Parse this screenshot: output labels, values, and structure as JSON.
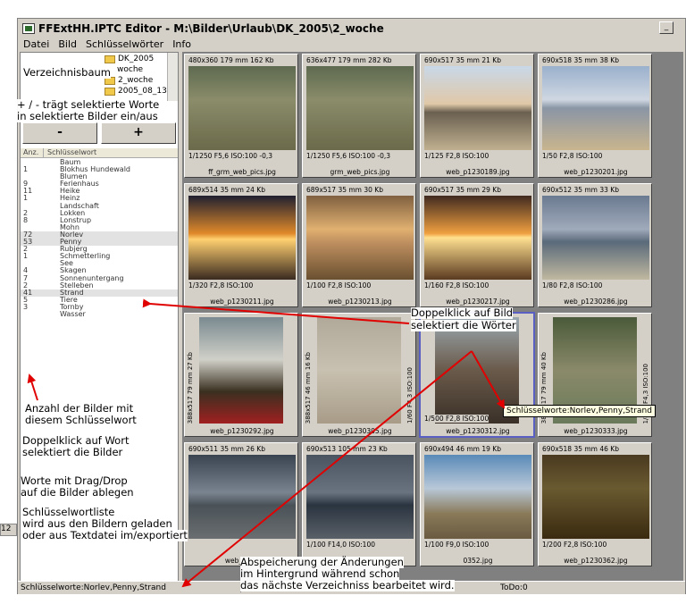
{
  "window": {
    "title": "FFExtHH.IPTC Editor - M:\\Bilder\\Urlaub\\DK_2005\\2_woche"
  },
  "menu": [
    "Datei",
    "Bild",
    "Schlüsselwörter",
    "Info"
  ],
  "tree": {
    "nodes": [
      "DK_2005",
      "woche",
      "2_woche",
      "2005_08_13"
    ]
  },
  "buttons": {
    "minus": "-",
    "plus": "+"
  },
  "keyword_table": {
    "headers": [
      "Anz.",
      "Schlüsselwort"
    ],
    "rows": [
      {
        "count": "",
        "word": "Baum",
        "selected": false
      },
      {
        "count": "1",
        "word": "Blokhus Hundewald",
        "selected": false
      },
      {
        "count": "",
        "word": "Blumen",
        "selected": false
      },
      {
        "count": "9",
        "word": "Ferienhaus",
        "selected": false
      },
      {
        "count": "11",
        "word": "Heike",
        "selected": false
      },
      {
        "count": "1",
        "word": "Heinz",
        "selected": false
      },
      {
        "count": "",
        "word": "Landschaft",
        "selected": false
      },
      {
        "count": "2",
        "word": "Lokken",
        "selected": false
      },
      {
        "count": "8",
        "word": "Lonstrup",
        "selected": false
      },
      {
        "count": "",
        "word": "Mohn",
        "selected": false
      },
      {
        "count": "72",
        "word": "Norlev",
        "selected": true
      },
      {
        "count": "53",
        "word": "Penny",
        "selected": true
      },
      {
        "count": "2",
        "word": "Rubjerg",
        "selected": false
      },
      {
        "count": "1",
        "word": "Schmetterling",
        "selected": false
      },
      {
        "count": "",
        "word": "See",
        "selected": false
      },
      {
        "count": "4",
        "word": "Skagen",
        "selected": false
      },
      {
        "count": "7",
        "word": "Sonnenuntergang",
        "selected": false
      },
      {
        "count": "2",
        "word": "Stelleben",
        "selected": false
      },
      {
        "count": "41",
        "word": "Strand",
        "selected": true
      },
      {
        "count": "5",
        "word": "Tiere",
        "selected": false
      },
      {
        "count": "3",
        "word": "Tornby",
        "selected": false
      },
      {
        "count": "",
        "word": "Wasser",
        "selected": false
      }
    ]
  },
  "thumbnails": [
    {
      "info": "480x360 179 mm 162 Kb",
      "exif": "1/1250 F5,6 ISO:100 -0,3",
      "file": "ff_grm_web_pics.jpg"
    },
    {
      "info": "636x477 179 mm 282 Kb",
      "exif": "1/1250 F5,6 ISO:100 -0,3",
      "file": "grm_web_pics.jpg"
    },
    {
      "info": "690x517 35 mm 21 Kb",
      "exif": "1/125 F2,8 ISO:100",
      "file": "web_p1230189.jpg"
    },
    {
      "info": "690x518 35 mm 38 Kb",
      "exif": "1/50 F2,8 ISO:100",
      "file": "web_p1230201.jpg"
    },
    {
      "info": "689x514 35 mm 24 Kb",
      "exif": "1/320 F2,8 ISO:100",
      "file": "web_p1230211.jpg"
    },
    {
      "info": "689x517 35 mm 30 Kb",
      "exif": "1/100 F2,8 ISO:100",
      "file": "web_p1230213.jpg"
    },
    {
      "info": "690x517 35 mm 29 Kb",
      "exif": "1/160 F2,8 ISO:100",
      "file": "web_p1230217.jpg"
    },
    {
      "info": "690x512 35 mm 33 Kb",
      "exif": "1/80 F2,8 ISO:100",
      "file": "web_p1230286.jpg"
    },
    {
      "info": "388x517 79 mm 27 Kb",
      "exif": "",
      "file": "web_p1230292.jpg"
    },
    {
      "info": "388x517 46 mm 16 Kb",
      "exif": "1/60 F4,3 ISO:100",
      "file": "web_p1230305.jpg"
    },
    {
      "info": "",
      "exif": "1/500 F2,8 ISO:100",
      "file": "web_p1230312.jpg"
    },
    {
      "info": "388x517 79 mm 40 Kb",
      "exif": "1/800 F4,3 ISO:100",
      "file": "web_p1230333.jpg"
    },
    {
      "info": "690x511 35 mm 26 Kb",
      "exif": "",
      "file": "web_p123"
    },
    {
      "info": "690x513 105 mm 23 Kb",
      "exif": "1/100 F14,0 ISO:100",
      "file": ""
    },
    {
      "info": "690x494 46 mm 19 Kb",
      "exif": "1/100 F9,0 ISO:100",
      "file": "0352.jpg"
    },
    {
      "info": "690x518 35 mm 46 Kb",
      "exif": "1/200 F2,8 ISO:100",
      "file": "web_p1230362.jpg"
    }
  ],
  "tooltip": "Schlüsselworte:Norlev,Penny,Strand",
  "status": {
    "keywords": "Schlüsselworte:Norlev,Penny,Strand",
    "todo": "ToDo:0"
  },
  "left_edge_label": "12",
  "annotations": {
    "tree": "Verzeichnisbaum",
    "plusminus_1": "+ / - trägt selektierte Worte",
    "plusminus_2": "in selektierte Bilder ein/aus",
    "count_1": "Anzahl der Bilder mit",
    "count_2": "diesem Schlüsselwort",
    "dblword_1": "Doppelklick auf Wort",
    "dblword_2": "selektiert die Bilder",
    "drag_1": "Worte mit Drag/Drop",
    "drag_2": "auf die Bilder ablegen",
    "list_1": "Schlüsselwortliste",
    "list_2": "wird aus den Bildern geladen",
    "list_3": "oder aus Textdatei im/exportiert",
    "dblimg_1": "Doppelklick auf Bild",
    "dblimg_2": "selektiert die Wörter",
    "save_1": "Abspeicherung der Änderungen",
    "save_2": "im Hintergrund während schon",
    "save_3": "das nächste Verzeichniss bearbeitet wird."
  },
  "colors": {
    "arrow": "#e00000",
    "selection": "#5a5fc4",
    "tooltip_bg": "#ffffe1"
  }
}
